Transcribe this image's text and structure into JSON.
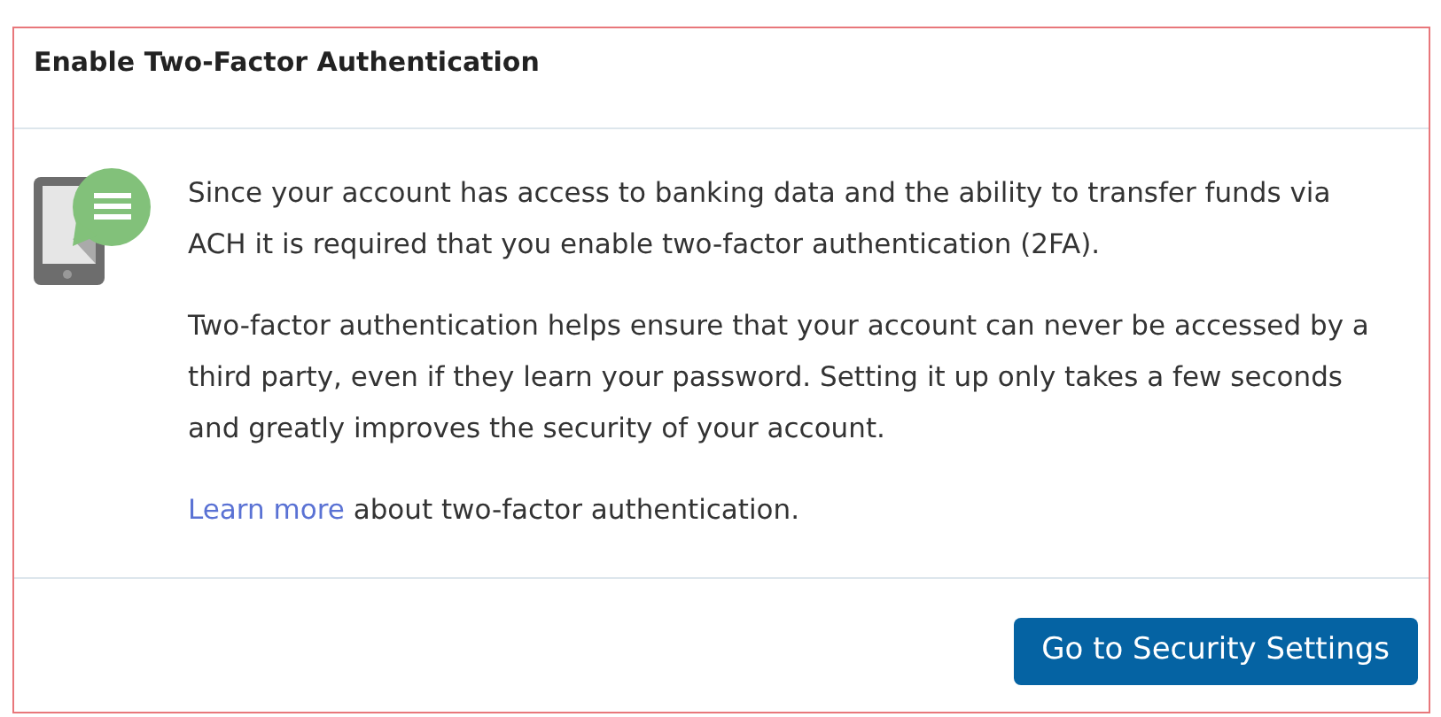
{
  "dialog": {
    "title": "Enable Two-Factor Authentication",
    "paragraphs": [
      "Since your account has access to banking data and the ability to transfer funds via ACH it is required that you enable two-factor authentication (2FA).",
      "Two-factor authentication helps ensure that your account can never be accessed by a third party, even if they learn your password. Setting it up only takes a few seconds and greatly improves the security of your account."
    ],
    "learn_more": {
      "link": "Learn more",
      "text": " about two-factor authentication."
    },
    "button": "Go to Security Settings"
  }
}
